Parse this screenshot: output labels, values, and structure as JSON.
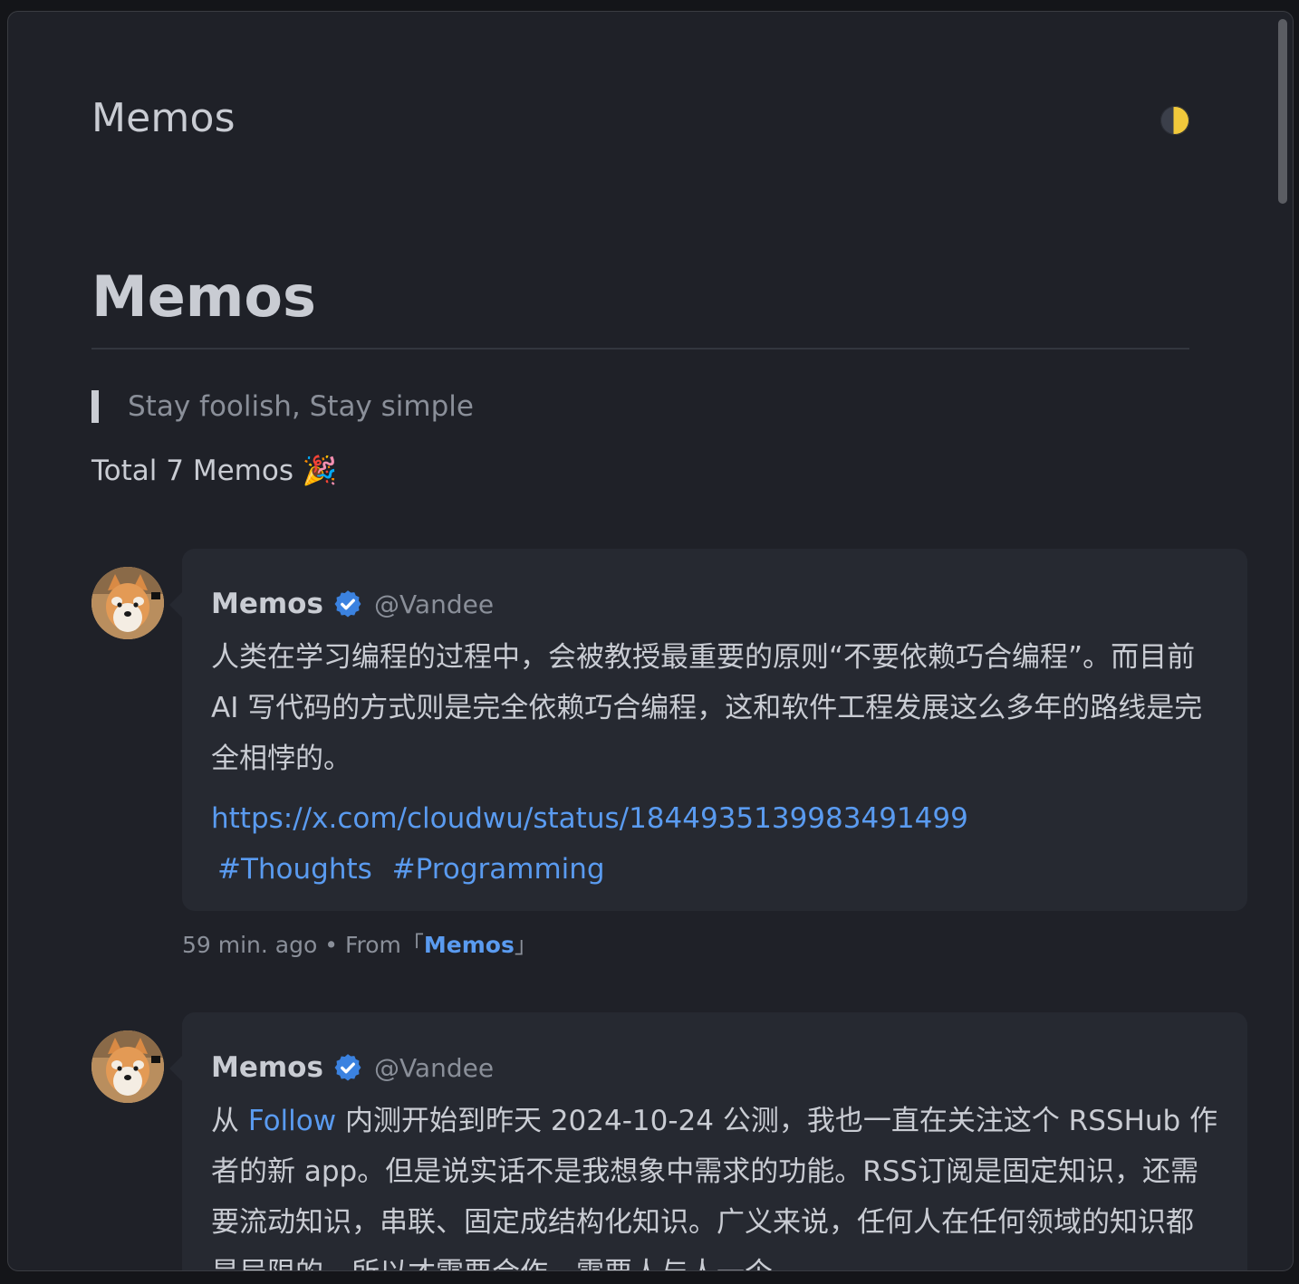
{
  "header": {
    "site_title": "Memos",
    "theme_icon": "moon-icon"
  },
  "main": {
    "heading": "Memos",
    "quote": "Stay foolish, Stay simple",
    "total": "Total 7 Memos 🎉"
  },
  "memos": [
    {
      "author": "Memos",
      "handle": "@Vandee",
      "content_text": "人类在学习编程的过程中，会被教授最重要的原则“不要依赖巧合编程”。而目前 AI 写代码的方式则是完全依赖巧合编程，这和软件工程发展这么多年的路线是完全相悖的。",
      "link": "https://x.com/cloudwu/status/1844935139983491499",
      "tags": [
        "#Thoughts",
        "#Programming"
      ],
      "time": "59 min. ago",
      "from_label": "From",
      "source_open": "「",
      "source": "Memos",
      "source_close": "」",
      "separator": "•"
    },
    {
      "author": "Memos",
      "handle": "@Vandee",
      "content_prefix": "从 ",
      "content_link": "Follow",
      "content_rest": " 内测开始到昨天 2024-10-24 公测，我也一直在关注这个 RSSHub 作者的新 app。但是说实话不是我想象中需求的功能。RSS订阅是固定知识，还需要流动知识，串联、固定成结构化知识。广义来说，任何人在任何领域的知识都是局限的，所以才需要合作，需要人与人一个"
    }
  ],
  "colors": {
    "background": "#1f2128",
    "card": "#262931",
    "text": "#c9ccd3",
    "muted": "#8a8f99",
    "link": "#5a9bf0",
    "verified": "#3b82e0"
  }
}
